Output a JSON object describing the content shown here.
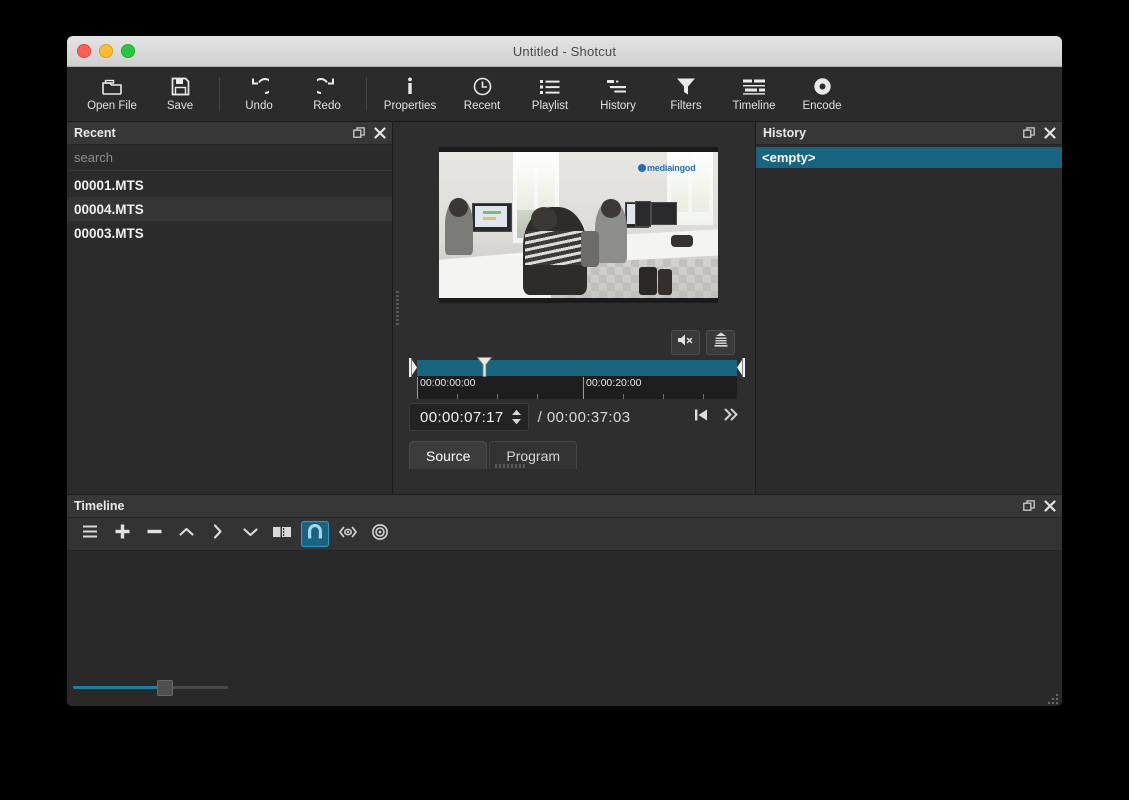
{
  "window": {
    "title": "Untitled - Shotcut",
    "traffic_lights": [
      "close",
      "minimize",
      "maximize"
    ]
  },
  "toolbar": {
    "buttons": [
      {
        "label": "Open File",
        "icon": "folder-open-icon"
      },
      {
        "label": "Save",
        "icon": "floppy-save-icon"
      },
      {
        "label": "Undo",
        "icon": "undo-arrow-icon"
      },
      {
        "label": "Redo",
        "icon": "redo-arrow-icon"
      },
      {
        "label": "Properties",
        "icon": "info-icon"
      },
      {
        "label": "Recent",
        "icon": "clock-icon"
      },
      {
        "label": "Playlist",
        "icon": "list-icon"
      },
      {
        "label": "History",
        "icon": "history-icon"
      },
      {
        "label": "Filters",
        "icon": "funnel-icon"
      },
      {
        "label": "Timeline",
        "icon": "timeline-icon"
      },
      {
        "label": "Encode",
        "icon": "disc-record-icon"
      }
    ]
  },
  "recent_panel": {
    "title": "Recent",
    "search_placeholder": "search",
    "float_icon": "float-window-icon",
    "close_icon": "close-icon",
    "items": [
      {
        "name": "00001.MTS",
        "selected": false
      },
      {
        "name": "00004.MTS",
        "selected": true
      },
      {
        "name": "00003.MTS",
        "selected": false
      }
    ]
  },
  "player": {
    "video_logo_text": "mediaingod",
    "mute_button_icon": "speaker-muted-icon",
    "levels_button_icon": "audio-levels-icon",
    "scrubber": {
      "tick_labels": [
        "00:00:00:00",
        "00:00:20:00"
      ],
      "in_point_icon": "in-point-marker",
      "out_point_icon": "out-point-marker",
      "playhead_icon": "playhead-marker",
      "playhead_percent": 20
    },
    "current_timecode": "00:00:07:17",
    "duration_separator": "/",
    "total_timecode": "00:00:37:03",
    "skip_start_icon": "skip-to-start-icon",
    "fast_forward_icon": "fast-forward-icon",
    "tabs": [
      {
        "label": "Source",
        "active": true
      },
      {
        "label": "Program",
        "active": false
      }
    ]
  },
  "history_panel": {
    "title": "History",
    "float_icon": "float-window-icon",
    "close_icon": "close-icon",
    "items": [
      {
        "label": "<empty>",
        "selected": true
      }
    ]
  },
  "timeline_panel": {
    "title": "Timeline",
    "float_icon": "float-window-icon",
    "close_icon": "close-icon",
    "tools": [
      {
        "name": "timeline-menu-button",
        "icon": "hamburger-menu-icon",
        "active": false
      },
      {
        "name": "append-button",
        "icon": "plus-icon",
        "active": false
      },
      {
        "name": "ripple-delete-button",
        "icon": "minus-icon",
        "active": false
      },
      {
        "name": "lift-button",
        "icon": "chevron-up-icon",
        "active": false
      },
      {
        "name": "overwrite-button",
        "icon": "chevron-right-icon",
        "active": false
      },
      {
        "name": "split-button",
        "icon": "chevron-down-icon",
        "active": false
      },
      {
        "name": "split-clip-button",
        "icon": "split-clip-icon",
        "active": false
      },
      {
        "name": "snap-button",
        "icon": "magnet-icon",
        "active": true
      },
      {
        "name": "scrub-drag-button",
        "icon": "scrub-while-dragging-icon",
        "active": false
      },
      {
        "name": "ripple-all-tracks-button",
        "icon": "ripple-all-tracks-icon",
        "active": false
      }
    ],
    "zoom_slider_percent": 57
  }
}
